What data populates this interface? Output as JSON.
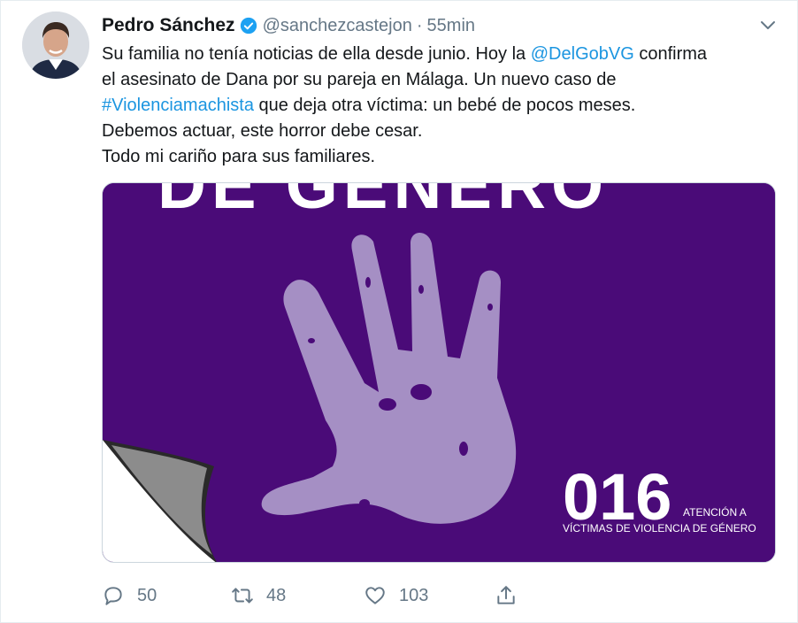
{
  "tweet": {
    "author": {
      "name": "Pedro Sánchez",
      "handle": "@sanchezcastejon",
      "separator": "·",
      "time": "55min"
    },
    "text_lines": [
      [
        {
          "t": "Su familia no tenía noticias de ella desde junio. Hoy la "
        },
        {
          "t": "@DelGobVG",
          "link": true
        },
        {
          "t": " confirma"
        }
      ],
      [
        {
          "t": "el asesinato de Dana por su pareja en Málaga. Un nuevo caso de"
        }
      ],
      [
        {
          "t": "#Violenciamachista",
          "link": true
        },
        {
          "t": " que deja otra víctima: un bebé de pocos meses."
        }
      ],
      [
        {
          "t": "Debemos actuar, este horror debe cesar."
        }
      ],
      [
        {
          "t": "Todo mi cariño para sus familiares."
        }
      ]
    ],
    "media": {
      "banner_text": "DE GÉNERO",
      "phone_number": "016",
      "caption_line1": "ATENCIÓN A",
      "caption_line2": "VÍCTIMAS DE VIOLENCIA DE GÉNERO",
      "colors": {
        "background": "#4a0b78",
        "hand": "#a58fc4",
        "text": "#ffffff"
      }
    },
    "actions": {
      "replies": "50",
      "retweets": "48",
      "likes": "103"
    }
  },
  "colors": {
    "link": "#1b95e0",
    "secondary": "#657786",
    "verified": "#1da1f2"
  }
}
